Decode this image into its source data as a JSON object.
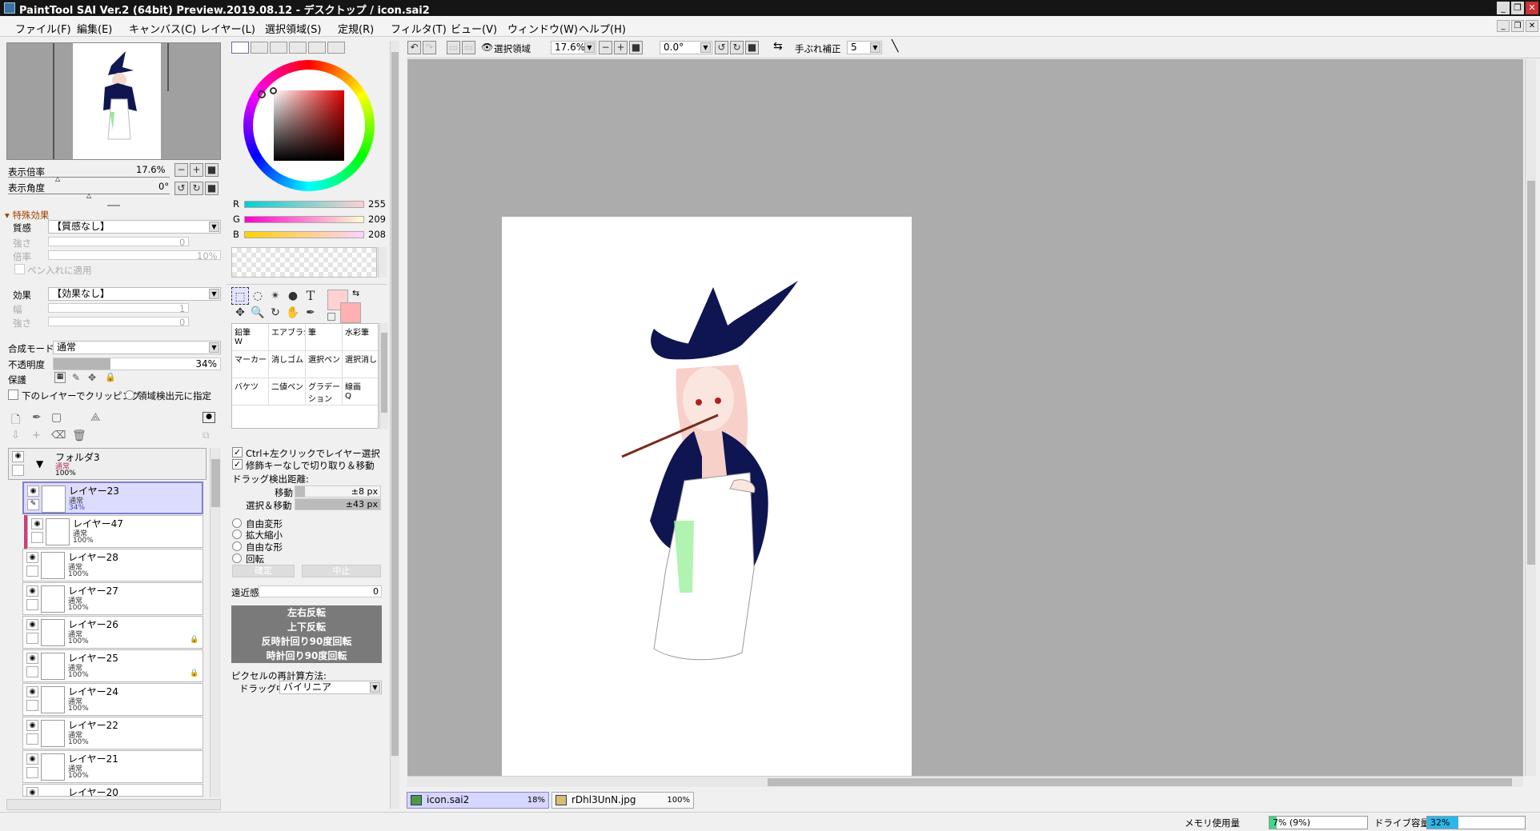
{
  "window": {
    "title": "PaintTool SAI Ver.2 (64bit) Preview.2019.08.12 - デスクトップ / icon.sai2",
    "min": "_",
    "max": "❐",
    "close": "✕"
  },
  "menu": [
    "ファイル(F)",
    "編集(E)",
    "キャンバス(C)",
    "レイヤー(L)",
    "選択領域(S)",
    "定規(R)",
    "フィルタ(T)",
    "ビュー(V)",
    "ウィンドウ(W)",
    "ヘルプ(H)"
  ],
  "nav": {
    "zoom_label": "表示倍率",
    "zoom_value": "17.6%",
    "angle_label": "表示角度",
    "angle_value": "0°"
  },
  "effects": {
    "header": "特殊効果",
    "texture_label": "質感",
    "texture_value": "【質感なし】",
    "strength_label": "強さ",
    "strength_value": "0",
    "scale_label": "倍率",
    "scale_value": "10%",
    "apply_pen": "ペン入れに適用",
    "effect_label": "効果",
    "effect_value": "【効果なし】",
    "width_label": "幅",
    "width_value": "1",
    "strength2_label": "強さ",
    "strength2_value": "0"
  },
  "layer_props": {
    "blend_label": "合成モード",
    "blend_value": "通常",
    "opacity_label": "不透明度",
    "opacity_value": "34%",
    "opacity_fraction": 0.34,
    "protect_label": "保護",
    "clip_label": "下のレイヤーでクリッピング",
    "source_label": "領域検出元に指定"
  },
  "layers": [
    {
      "name": "フォルダ3",
      "mode": "通常",
      "opacity": "100%"
    },
    {
      "name": "レイヤー23",
      "mode": "通常",
      "opacity": "34%"
    },
    {
      "name": "レイヤー47",
      "mode": "通常",
      "opacity": "100%"
    },
    {
      "name": "レイヤー28",
      "mode": "通常",
      "opacity": "100%"
    },
    {
      "name": "レイヤー27",
      "mode": "通常",
      "opacity": "100%"
    },
    {
      "name": "レイヤー26",
      "mode": "通常",
      "opacity": "100%"
    },
    {
      "name": "レイヤー25",
      "mode": "通常",
      "opacity": "100%"
    },
    {
      "name": "レイヤー24",
      "mode": "通常",
      "opacity": "100%"
    },
    {
      "name": "レイヤー22",
      "mode": "通常",
      "opacity": "100%"
    },
    {
      "name": "レイヤー21",
      "mode": "通常",
      "opacity": "100%"
    },
    {
      "name": "レイヤー20",
      "mode": "",
      "opacity": ""
    }
  ],
  "color": {
    "r_label": "R",
    "r": "255",
    "g_label": "G",
    "g": "209",
    "b_label": "B",
    "b": "208",
    "fg": "#ffd1d0",
    "bg": "#ffb0b0"
  },
  "brushes": [
    {
      "name": "鉛筆",
      "key": "W"
    },
    {
      "name": "エアブラシ",
      "key": ""
    },
    {
      "name": "筆",
      "key": ""
    },
    {
      "name": "水彩筆",
      "key": ""
    },
    {
      "name": "マーカー",
      "key": ""
    },
    {
      "name": "消しゴム",
      "key": ""
    },
    {
      "name": "選択ペン",
      "key": ""
    },
    {
      "name": "選択消し",
      "key": ""
    },
    {
      "name": "バケツ",
      "key": ""
    },
    {
      "name": "二値ペン",
      "key": ""
    },
    {
      "name": "グラデーション",
      "key": ""
    },
    {
      "name": "線画",
      "key": "Q"
    }
  ],
  "options": {
    "ctrl_select": "Ctrl+左クリックでレイヤー選択",
    "cut_move": "修飾キーなしで切り取り＆移動",
    "drag_label": "ドラッグ検出距離:",
    "move_label": "移動",
    "move_value": "±8 px",
    "selmove_label": "選択＆移動",
    "selmove_value": "±43 px"
  },
  "transform": {
    "free": "自由変形",
    "scale": "拡大縮小",
    "free_shape": "自由な形",
    "rotate": "回転",
    "ok": "確定",
    "cancel": "中止",
    "perspective_label": "遠近感",
    "perspective_value": "0"
  },
  "actions": [
    "左右反転",
    "上下反転",
    "反時計回り90度回転",
    "時計回り90度回転"
  ],
  "resample": {
    "label": "ピクセルの再計算方法:",
    "drag_label": "ドラッグ中",
    "drag_value": "バイリニア"
  },
  "toolbar": {
    "selection_label": "選択領域",
    "zoom": "17.6%",
    "angle": "0.0°",
    "stabilizer_label": "手ぶれ補正",
    "stabilizer": "5"
  },
  "tabs": [
    {
      "name": "icon.sai2",
      "pct": "18%"
    },
    {
      "name": "rDhl3UnN.jpg",
      "pct": "100%"
    }
  ],
  "status": {
    "mem_label": "メモリ使用量",
    "mem_value": "7% (9%)",
    "mem_fraction": 0.07,
    "drive_label": "ドライブ容量",
    "drive_value": "32%",
    "drive_fraction": 0.32
  }
}
